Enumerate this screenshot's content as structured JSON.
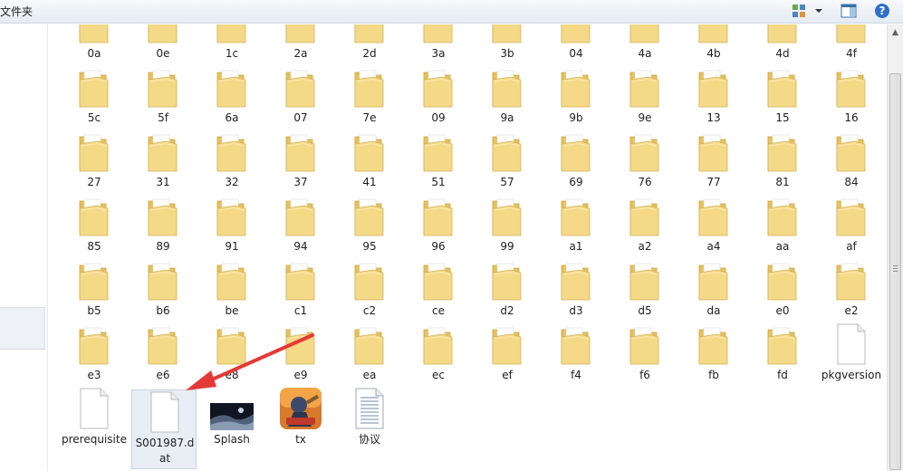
{
  "window": {
    "title_fragment": "文件夹"
  },
  "folders": [
    "0a",
    "0e",
    "1c",
    "2a",
    "2d",
    "3a",
    "3b",
    "04",
    "4a",
    "4b",
    "4d",
    "4f",
    "5c",
    "5f",
    "6a",
    "07",
    "7e",
    "09",
    "9a",
    "9b",
    "9e",
    "13",
    "15",
    "16",
    "27",
    "31",
    "32",
    "37",
    "41",
    "51",
    "57",
    "69",
    "76",
    "77",
    "81",
    "84",
    "85",
    "89",
    "91",
    "94",
    "95",
    "96",
    "99",
    "a1",
    "a2",
    "a4",
    "aa",
    "af",
    "b5",
    "b6",
    "be",
    "c1",
    "c2",
    "ce",
    "d2",
    "d3",
    "d5",
    "da",
    "e0",
    "e2",
    "e3",
    "e6",
    "e8",
    "e9",
    "ea",
    "ec",
    "ef",
    "f4",
    "f6",
    "fb",
    "fd"
  ],
  "files": [
    {
      "name": "pkgversion",
      "label": "pkgversion",
      "kind": "blank-file"
    },
    {
      "name": "prerequisite",
      "label": "prerequisite",
      "kind": "blank-file"
    },
    {
      "name": "S001987.dat",
      "label": "S001987.dat",
      "kind": "blank-file",
      "selected": true
    },
    {
      "name": "Splash",
      "label": "Splash",
      "kind": "image-thumbnail"
    },
    {
      "name": "tx",
      "label": "tx",
      "kind": "game-app-icon"
    },
    {
      "name": "协议",
      "label": "协议",
      "kind": "text-document"
    }
  ],
  "icons": {
    "views": "view-options-icon",
    "preview": "preview-pane-icon",
    "help": "help-icon"
  },
  "watermark": "",
  "colors": {
    "folder": "#f1d780",
    "arrow": "#e53935",
    "selection": "#e9eef5"
  }
}
